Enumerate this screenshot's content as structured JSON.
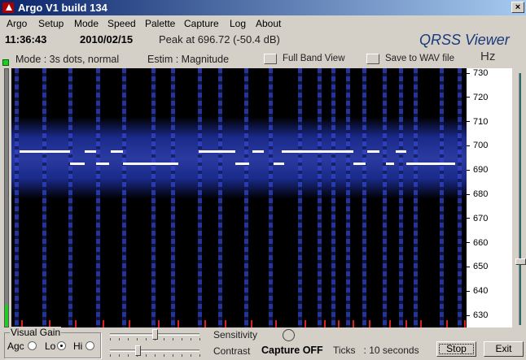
{
  "window": {
    "title": "Argo V1 build 134",
    "close_label": "×"
  },
  "menu": [
    "Argo",
    "Setup",
    "Mode",
    "Speed",
    "Palette",
    "Capture",
    "Log",
    "About"
  ],
  "status": {
    "time": "11:36:43",
    "date": "2010/02/15",
    "peak": "Peak at 696.72 (-50.4 dB)"
  },
  "brand": "QRSS Viewer",
  "unit": "Hz",
  "mode_text": "Mode : 3s dots, normal",
  "estim_text": "Estim : Magnitude",
  "full_band_label": "Full Band View",
  "save_wav_label": "Save to WAV file",
  "scale_labels": [
    "730",
    "720",
    "710",
    "700",
    "690",
    "680",
    "670",
    "660",
    "650",
    "640",
    "630"
  ],
  "visual_gain": {
    "title": "Visual Gain",
    "agc": "Agc",
    "lo": "Lo",
    "hi": "Hi",
    "selected": "Lo"
  },
  "sensitivity_label": "Sensitivity",
  "contrast_label": "Contrast",
  "sensitivity_value": 0.5,
  "contrast_value": 0.3,
  "capture_status": "Capture OFF",
  "ticks_text": "Ticks   : 10 seconds",
  "stop_label": "Stop",
  "exit_label": "Exit",
  "colors": {
    "title_start": "#0a246a",
    "title_end": "#a6caf0",
    "signal": "#ffffff",
    "band": "#1a2a8a",
    "marker": "#e02020"
  }
}
